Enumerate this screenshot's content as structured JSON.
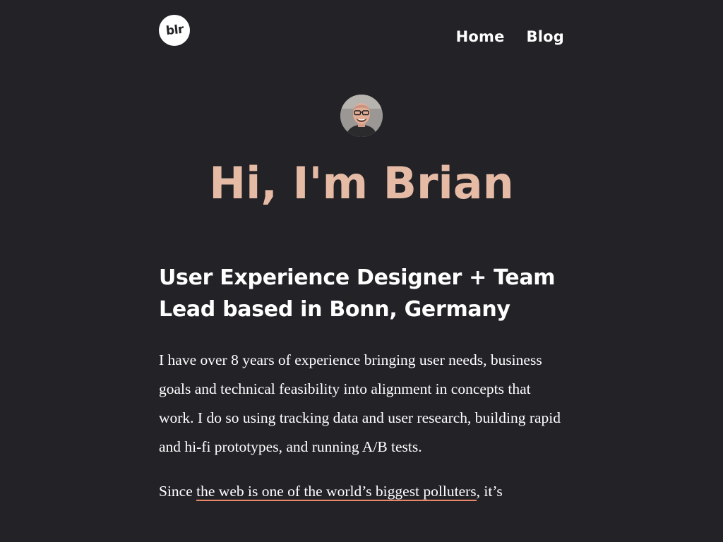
{
  "header": {
    "logo_text": "blr",
    "nav": [
      {
        "label": "Home"
      },
      {
        "label": "Blog"
      }
    ]
  },
  "hero": {
    "title": "Hi, I'm Brian"
  },
  "main": {
    "subtitle": "User Experience Designer + Team Lead based in Bonn, Germany",
    "intro": "I have over 8 years of experience bringing user needs, business goals and technical feasibility into alignment in concepts that work. I do so using tracking data and user research, building rapid and hi-fi prototypes, and running A/B tests.",
    "second_prefix": "Since ",
    "second_link": "the web is one of the world’s biggest polluters",
    "second_suffix": ", it’s"
  },
  "colors": {
    "background": "#232227",
    "accent": "#e6bba6",
    "link_underline": "#e8866a",
    "text": "#ffffff"
  }
}
